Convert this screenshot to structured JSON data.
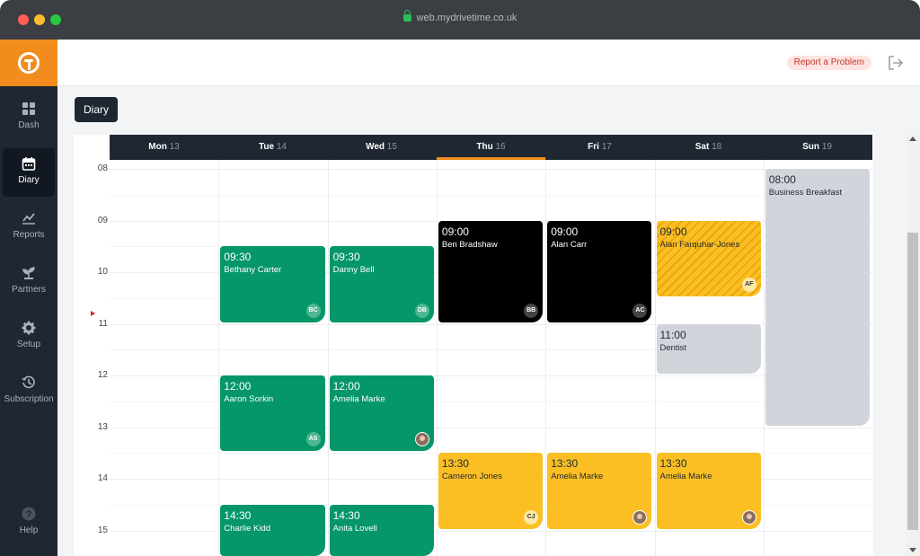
{
  "browser": {
    "url": "web.mydrivetime.co.uk"
  },
  "sidebar": {
    "items": [
      {
        "label": "Dash",
        "icon": "dashboard-icon"
      },
      {
        "label": "Diary",
        "icon": "calendar-icon",
        "active": true
      },
      {
        "label": "Reports",
        "icon": "chart-icon"
      },
      {
        "label": "Partners",
        "icon": "handshake-icon"
      },
      {
        "label": "Setup",
        "icon": "gear-icon"
      },
      {
        "label": "Subscription",
        "icon": "history-icon"
      }
    ],
    "help": {
      "label": "Help",
      "icon": "question-icon"
    }
  },
  "header": {
    "report_label": "Report a Problem"
  },
  "page": {
    "tab": "Diary"
  },
  "days": [
    {
      "name": "Mon",
      "num": "13"
    },
    {
      "name": "Tue",
      "num": "14"
    },
    {
      "name": "Wed",
      "num": "15"
    },
    {
      "name": "Thu",
      "num": "16"
    },
    {
      "name": "Fri",
      "num": "17"
    },
    {
      "name": "Sat",
      "num": "18"
    },
    {
      "name": "Sun",
      "num": "19"
    }
  ],
  "hours": [
    "08",
    "09",
    "10",
    "11",
    "12",
    "13",
    "14",
    "15"
  ],
  "events": [
    {
      "day": 1,
      "time": "09:30",
      "name": "Bethany Carter",
      "initials": "BC",
      "style": "green"
    },
    {
      "day": 2,
      "time": "09:30",
      "name": "Danny Bell",
      "initials": "DB",
      "style": "green"
    },
    {
      "day": 3,
      "time": "09:00",
      "name": "Ben Bradshaw",
      "initials": "BB",
      "style": "black"
    },
    {
      "day": 4,
      "time": "09:00",
      "name": "Alan Carr",
      "initials": "AC",
      "style": "black"
    },
    {
      "day": 5,
      "time": "09:00",
      "name": "Alan Farquhar-Jones",
      "initials": "AF",
      "style": "stripe"
    },
    {
      "day": 5,
      "time": "11:00",
      "name": "Dentist",
      "initials": "",
      "style": "grey"
    },
    {
      "day": 6,
      "time": "08:00",
      "name": "Business Breakfast",
      "initials": "",
      "style": "grey"
    },
    {
      "day": 1,
      "time": "12:00",
      "name": "Aaron Sorkin",
      "initials": "AS",
      "style": "green"
    },
    {
      "day": 2,
      "time": "12:00",
      "name": "Amelia Marke",
      "initials": "",
      "style": "green"
    },
    {
      "day": 3,
      "time": "13:30",
      "name": "Cameron Jones",
      "initials": "CJ",
      "style": "yellow"
    },
    {
      "day": 4,
      "time": "13:30",
      "name": "Amelia Marke",
      "initials": "",
      "style": "yellow"
    },
    {
      "day": 5,
      "time": "13:30",
      "name": "Amelia Marke",
      "initials": "",
      "style": "yellow"
    },
    {
      "day": 1,
      "time": "14:30",
      "name": "Charlie Kidd",
      "initials": "",
      "style": "green"
    },
    {
      "day": 2,
      "time": "14:30",
      "name": "Anita Lovell",
      "initials": "",
      "style": "green"
    }
  ]
}
